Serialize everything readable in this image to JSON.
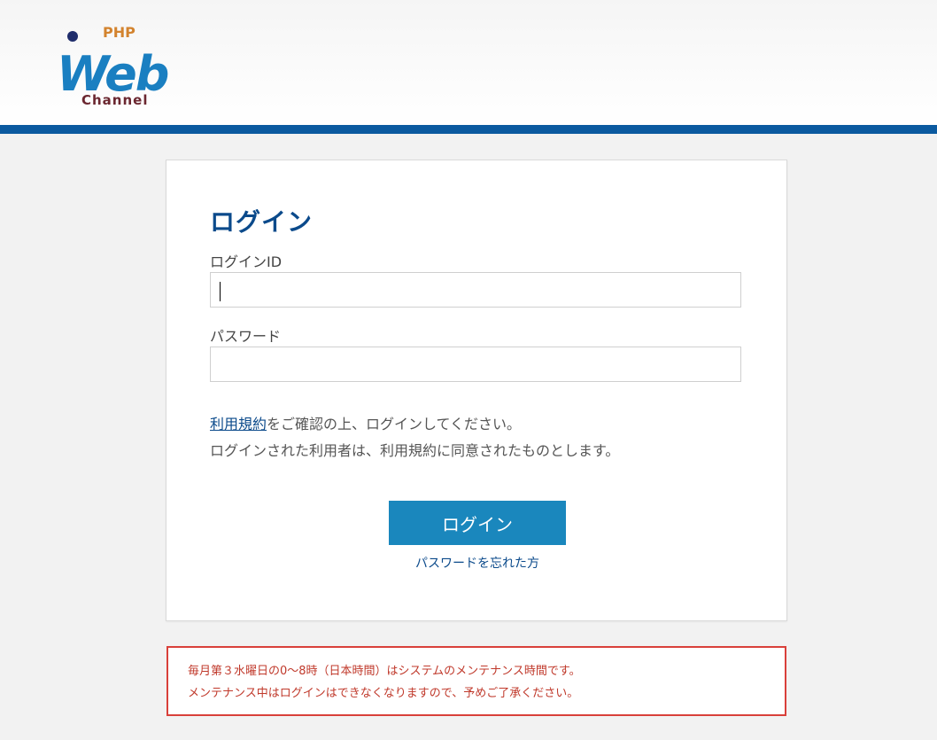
{
  "logo": {
    "top_text": "PHP",
    "main_text": "Web",
    "sub_text": "Channel"
  },
  "colors": {
    "brand_blue": "#0b5aa0",
    "title_blue": "#0b4a8b",
    "button_blue": "#1a87bd",
    "warning_red": "#d9403a",
    "logo_orange": "#d3832e",
    "logo_maroon": "#6b2730"
  },
  "login": {
    "title": "ログイン",
    "id_label": "ログインID",
    "id_value": "",
    "password_label": "パスワード",
    "password_value": "",
    "terms_link": "利用規約",
    "terms_line1_rest": "をご確認の上、ログインしてください。",
    "terms_line2": "ログインされた利用者は、利用規約に同意されたものとします。",
    "submit_label": "ログイン",
    "forgot_password": "パスワードを忘れた方"
  },
  "maintenance": {
    "line1": "毎月第３水曜日の0～8時（日本時間）はシステムのメンテナンス時間です。",
    "line2": "メンテナンス中はログインはできなくなりますので、予めご了承ください。"
  }
}
